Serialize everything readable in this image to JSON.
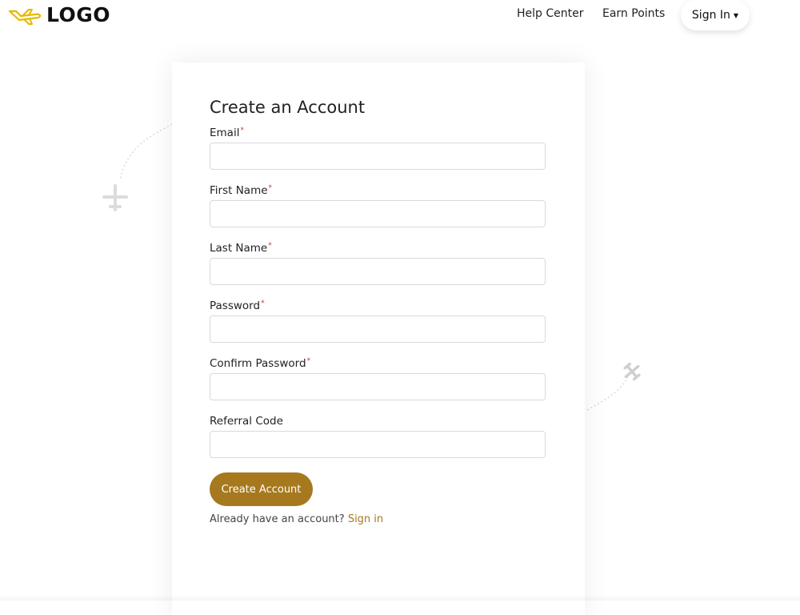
{
  "header": {
    "logo_text": "LOGO",
    "logo_icon": "airplane-icon",
    "nav": {
      "help_center": "Help Center",
      "earn_points": "Earn Points",
      "sign_in": "Sign In"
    }
  },
  "form": {
    "title": "Create an Account",
    "required_marker": "*",
    "fields": [
      {
        "label": "Email",
        "required": true,
        "value": ""
      },
      {
        "label": "First Name",
        "required": true,
        "value": ""
      },
      {
        "label": "Last Name",
        "required": true,
        "value": ""
      },
      {
        "label": "Password",
        "required": true,
        "value": ""
      },
      {
        "label": "Confirm Password",
        "required": true,
        "value": ""
      },
      {
        "label": "Referral Code",
        "required": false,
        "value": ""
      }
    ],
    "submit_label": "Create Account",
    "already_text": "Already have an account?",
    "signin_link": "Sign in"
  },
  "colors": {
    "accent": "#a6791f",
    "logo_accent": "#e6b800",
    "required": "#c0392b"
  }
}
